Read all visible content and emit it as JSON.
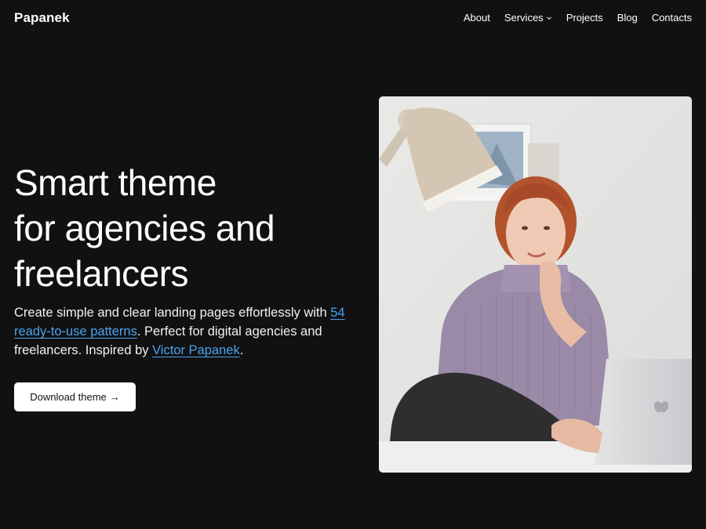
{
  "header": {
    "brand": "Papanek",
    "nav": [
      {
        "label": "About"
      },
      {
        "label": "Services",
        "has_dropdown": true,
        "icon": "chevron-down-icon"
      },
      {
        "label": "Projects"
      },
      {
        "label": "Blog"
      },
      {
        "label": "Contacts"
      }
    ]
  },
  "hero": {
    "title_lines": [
      "Smart theme",
      "for agencies and",
      "freelancers"
    ],
    "lead_before": "Create simple and clear landing pages effortlessly with ",
    "lead_link1": "54 ready-to-use patterns",
    "lead_middle": ". Perfect for digital agencies and freelancers. Inspired by ",
    "lead_link2": "Victor Papanek",
    "lead_after": ".",
    "button_label": "Download theme",
    "button_icon": "arrow-right-icon"
  },
  "colors": {
    "background": "#111111",
    "text": "#ffffff",
    "link": "#4aa3f0",
    "button_bg": "#ffffff",
    "button_text": "#111111"
  }
}
